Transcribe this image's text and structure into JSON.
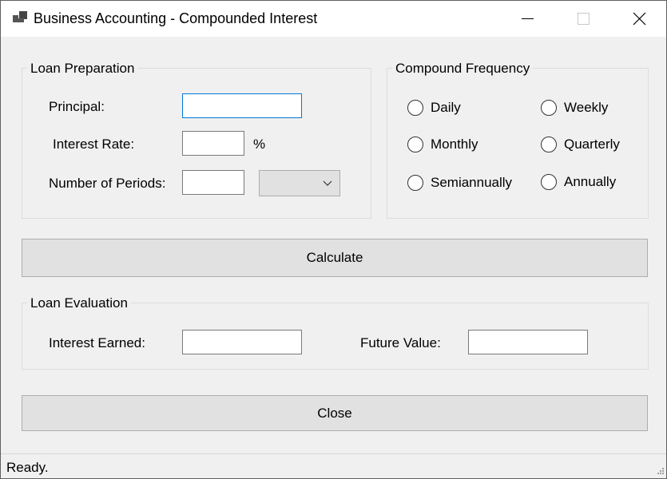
{
  "window": {
    "title": "Business Accounting - Compounded Interest",
    "icon": "app-window-icon",
    "controls": {
      "minimize": "minimize-icon",
      "maximize": "maximize-icon",
      "close": "close-icon"
    }
  },
  "loan_preparation": {
    "legend": "Loan Preparation",
    "principal": {
      "label": "Principal:",
      "value": "",
      "focused": true
    },
    "interest_rate": {
      "label": "Interest Rate:",
      "value": "",
      "suffix": "%"
    },
    "number_of_periods": {
      "label": "Number of Periods:",
      "value": "",
      "period_unit_selected": ""
    }
  },
  "compound_frequency": {
    "legend": "Compound Frequency",
    "options": [
      {
        "label": "Daily",
        "checked": false
      },
      {
        "label": "Weekly",
        "checked": false
      },
      {
        "label": "Monthly",
        "checked": false
      },
      {
        "label": "Quarterly",
        "checked": false
      },
      {
        "label": "Semiannually",
        "checked": false
      },
      {
        "label": "Annually",
        "checked": false
      }
    ]
  },
  "actions": {
    "calculate_label": "Calculate",
    "close_label": "Close"
  },
  "loan_evaluation": {
    "legend": "Loan Evaluation",
    "interest_earned": {
      "label": "Interest Earned:",
      "value": ""
    },
    "future_value": {
      "label": "Future Value:",
      "value": ""
    }
  },
  "status": {
    "text": "Ready."
  },
  "colors": {
    "window_bg": "#f0f0f0",
    "titlebar_bg": "#ffffff",
    "focus_border": "#0078d7",
    "button_bg": "#e1e1e1",
    "button_border": "#adadad"
  }
}
